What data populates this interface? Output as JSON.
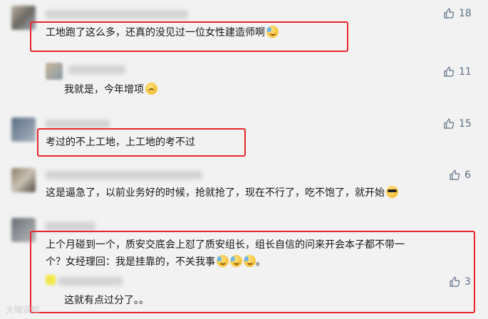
{
  "comments": [
    {
      "text": "工地跑了这么多，还真的没见过一位女性建造师啊",
      "likes": "18",
      "emoji": "sweat-smile-icon"
    },
    {
      "text": "我就是，今年增项",
      "likes": "11",
      "emoji": "upside-smile-icon"
    },
    {
      "text": "考过的不上工地，上工地的考不过",
      "likes": "15"
    },
    {
      "text": "这是逼急了，以前业务好的时候，抢就抢了，现在不行了，吃不饱了，就开始",
      "likes": "6",
      "emoji": "sunglasses-icon"
    },
    {
      "text_line1": "上个月碰到一个，质安交底会上怼了质安组长，组长自信的问来开会本子都不带一",
      "text_line2": "个？女经理回：我是挂靠的，不关我事",
      "text_tail": "。",
      "emoji": "sweat-smile-icon"
    },
    {
      "text": "这就有点过分了。。",
      "likes": "3"
    }
  ],
  "watermark": "大咖说检",
  "colors": {
    "highlight": "#e8262d",
    "like": "#5d6f86",
    "background": "#f2f2f2"
  }
}
